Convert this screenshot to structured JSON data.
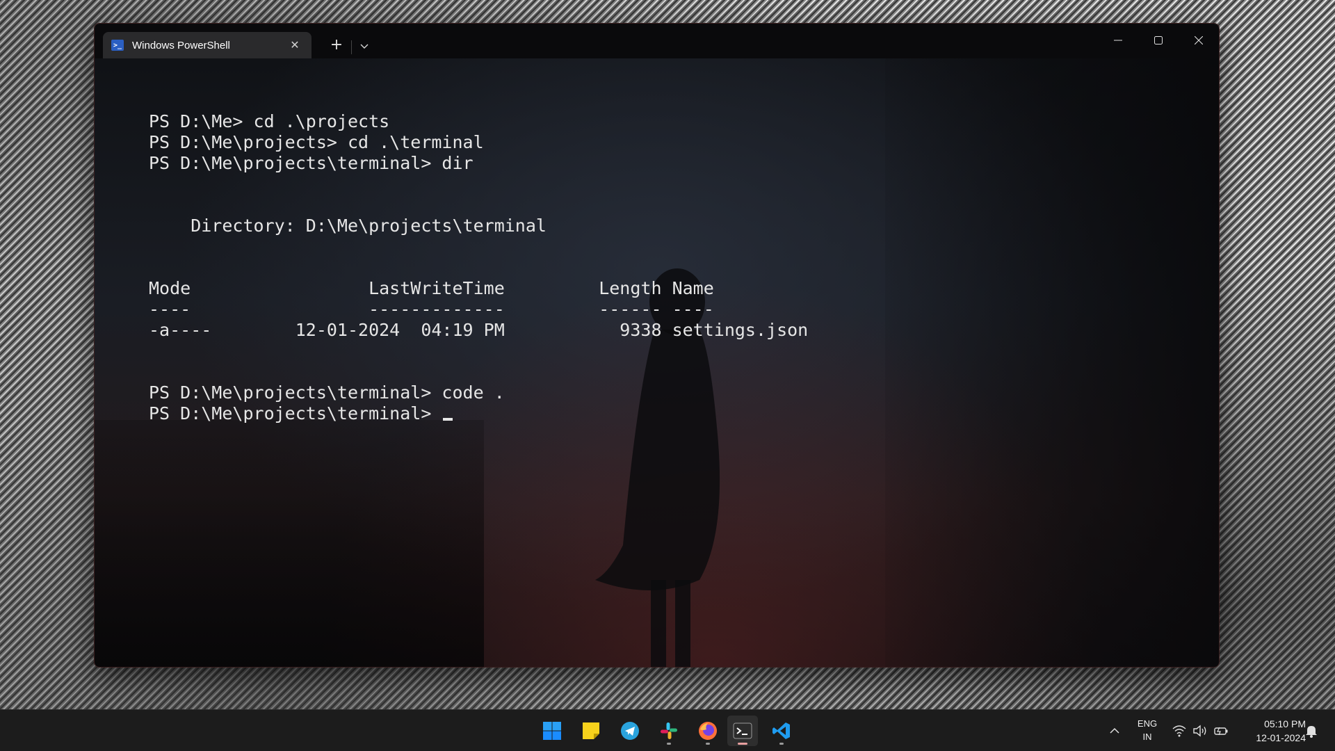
{
  "window": {
    "tab_title": "Windows PowerShell",
    "tab_icon": "powershell-icon",
    "tab_icon_glyph": ">_",
    "tab_close": "✕",
    "new_tab": "+",
    "dropdown_icon": "chevron-down-icon",
    "controls": [
      "minimize-icon",
      "maximize-icon",
      "close-icon"
    ]
  },
  "terminal": {
    "lines": [
      "PS D:\\Me> cd .\\projects",
      "PS D:\\Me\\projects> cd .\\terminal",
      "PS D:\\Me\\projects\\terminal> dir",
      "",
      "",
      "    Directory: D:\\Me\\projects\\terminal",
      "",
      "",
      "Mode                 LastWriteTime         Length Name",
      "----                 -------------         ------ ----",
      "-a----        12-01-2024  04:19 PM           9338 settings.json",
      "",
      "",
      "PS D:\\Me\\projects\\terminal> code .",
      "PS D:\\Me\\projects\\terminal> "
    ]
  },
  "taskbar": {
    "apps": [
      {
        "name": "start-button",
        "icon": "windows-start-icon"
      },
      {
        "name": "sticky-notes-app",
        "icon": "sticky-notes-icon"
      },
      {
        "name": "telegram-app",
        "icon": "telegram-icon"
      },
      {
        "name": "slack-app",
        "icon": "slack-icon"
      },
      {
        "name": "firefox-app",
        "icon": "firefox-icon"
      },
      {
        "name": "terminal-app",
        "icon": "terminal-icon"
      },
      {
        "name": "vscode-app",
        "icon": "vscode-icon"
      }
    ],
    "tray": {
      "lang_line1": "ENG",
      "lang_line2": "IN",
      "time": "05:10 PM",
      "date": "12-01-2024",
      "icons": [
        "chevron-up-icon",
        "wifi-icon",
        "volume-icon",
        "battery-icon",
        "notification-bell-icon"
      ]
    }
  },
  "colors": {
    "terminal_text": "#e6e6e6",
    "taskbar_bg": "#1c1c1c",
    "titlebar_bg": "#0a0a0c",
    "tab_bg": "#2a2a2c",
    "windows_blue": "#1a8cff"
  }
}
